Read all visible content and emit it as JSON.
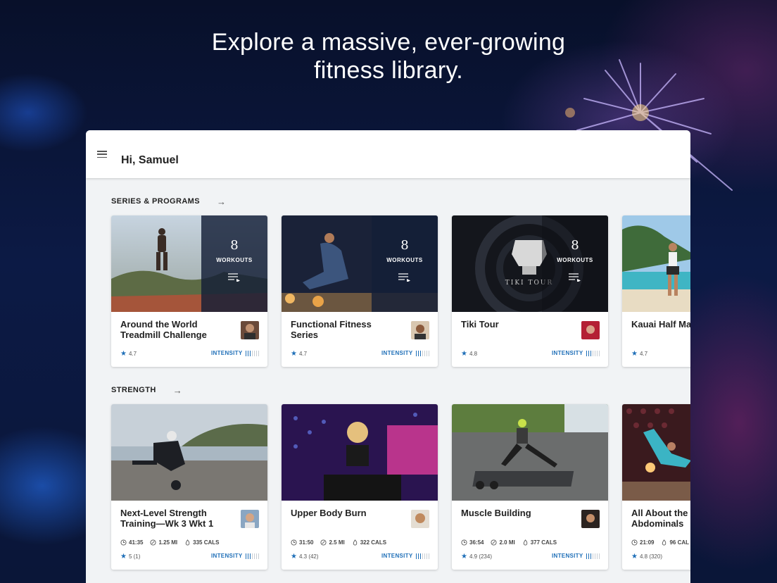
{
  "headline": {
    "line1": "Explore a massive, ever-growing",
    "line2": "fitness library."
  },
  "header": {
    "greeting": "Hi, Samuel",
    "menu_icon": "hamburger-menu-icon"
  },
  "sections": [
    {
      "title": "SERIES & PROGRAMS",
      "cards": [
        {
          "title": "Around the World Treadmill Challenge",
          "workout_count": "8",
          "workouts_label": "WORKOUTS",
          "rating": "4.7",
          "intensity_label": "INTENSITY",
          "intensity_level": 3,
          "intensity_max": 7
        },
        {
          "title": "Functional Fitness Series",
          "workout_count": "8",
          "workouts_label": "WORKOUTS",
          "rating": "4.7",
          "intensity_label": "INTENSITY",
          "intensity_level": 3,
          "intensity_max": 7
        },
        {
          "title": "Tiki Tour",
          "workout_count": "8",
          "workouts_label": "WORKOUTS",
          "rating": "4.8",
          "intensity_label": "INTENSITY",
          "intensity_level": 3,
          "intensity_max": 7,
          "thumb_text": "TIKI TOUR"
        },
        {
          "title": "Kauai Half Ma",
          "rating": "4.7"
        }
      ]
    },
    {
      "title": "STRENGTH",
      "cards": [
        {
          "title": "Next-Level Strength Training—Wk 3 Wkt 1",
          "duration": "41:35",
          "distance": "1.25 MI",
          "calories": "335 CALS",
          "rating": "5 (1)",
          "intensity_label": "INTENSITY",
          "intensity_level": 3,
          "intensity_max": 7
        },
        {
          "title": "Upper Body Burn",
          "duration": "31:50",
          "distance": "2.5 MI",
          "calories": "322 CALS",
          "rating": "4.3 (42)",
          "intensity_label": "INTENSITY",
          "intensity_level": 3,
          "intensity_max": 7
        },
        {
          "title": "Muscle Building",
          "duration": "36:54",
          "distance": "2.0 MI",
          "calories": "377 CALS",
          "rating": "4.9 (234)",
          "intensity_label": "INTENSITY",
          "intensity_level": 3,
          "intensity_max": 7
        },
        {
          "title": "All About the Abdominals",
          "duration": "21:09",
          "calories": "96 CAL",
          "rating": "4.8 (320)"
        }
      ]
    }
  ],
  "colors": {
    "accent": "#1f6fb8",
    "background": "#0c1a45",
    "panel": "#f1f3f5"
  }
}
